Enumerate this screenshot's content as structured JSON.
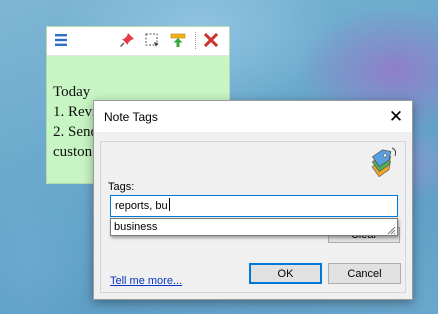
{
  "note": {
    "lines": [
      "Today",
      "1. Revi",
      "2. Send",
      "custon"
    ]
  },
  "note_toolbar": {
    "menu_icon": "hamburger-menu-icon",
    "pin_icon": "pushpin-icon",
    "select_icon": "dashed-square-icon",
    "export_icon": "arrow-into-tray-icon",
    "close_icon": "red-x-icon"
  },
  "dialog": {
    "title": "Note Tags",
    "close_label": "✕",
    "tags_label": "Tags:",
    "tags_value": "reports, bu",
    "suggestion": "business",
    "clear_label": "Clear",
    "link_text": "Tell me more...",
    "ok_label": "OK",
    "cancel_label": "Cancel",
    "icon": "tags-icon"
  },
  "colors": {
    "note_background": "#c8f5c4",
    "accent": "#0078d7",
    "link": "#0a36c4"
  }
}
